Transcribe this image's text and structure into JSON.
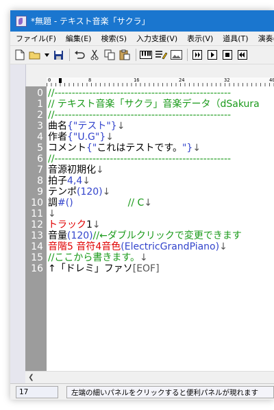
{
  "window": {
    "title": "*無題 - テキスト音楽「サクラ」"
  },
  "menu": {
    "items": [
      "ファイル(F)",
      "編集(E)",
      "検索(S)",
      "入力支援(V)",
      "表示(V)",
      "道具(T)",
      "演奏("
    ]
  },
  "toolbar": {
    "buttons": [
      "new-file-icon",
      "open-folder-icon",
      "dropdown-arrow-icon",
      "save-icon",
      "undo-icon",
      "cut-icon",
      "copy-icon",
      "paste-icon",
      "piano-icon",
      "edit-list-icon",
      "image-icon",
      "play-icon",
      "play-selection-icon",
      "stop-icon",
      "rewind-icon"
    ]
  },
  "ruler": {
    "labels": [
      "0",
      "8",
      "16",
      "24",
      "32",
      "40"
    ]
  },
  "editor": {
    "line_numbers": [
      "0",
      "1",
      "2",
      "3",
      "4",
      "5",
      "6",
      "7",
      "8",
      "9",
      "10",
      "11",
      "12",
      "13",
      "14",
      "15",
      "16"
    ],
    "lines": {
      "l0": "//---------------------------------------------------",
      "l1": "// テキスト音楽「サクラ」音楽データ（dSakura",
      "l2": "//---------------------------------------------------",
      "l3a": "曲名",
      "l3b": "{\"テスト\"}",
      "l3c": "↓",
      "l4a": "作者",
      "l4b": "{\"U.G\"}",
      "l4c": "↓",
      "l5a": "コメント",
      "l5b": "{\"",
      "l5c": "これはテストです。",
      "l5d": "\"}",
      "l5e": "↓",
      "l6": "//---------------------------------------------------",
      "l7a": "音源初期化",
      "l7b": "↓",
      "l8a": "拍子",
      "l8b": "4,4",
      "l8c": "↓",
      "l9a": "テンポ",
      "l9b": "(120)",
      "l9c": "↓",
      "l10a": "調",
      "l10b": "#()",
      "l10c": "// C",
      "l10d": "↓",
      "l11": "↓",
      "l12a": "トラック",
      "l12b": "1",
      "l12c": "↓",
      "l13a": "音量",
      "l13b": "(120)",
      "l13c": "//←ダブルクリックで変更できます",
      "l14a": "音階5 ",
      "l14b": "音符4",
      "l14c": "音色",
      "l14d": "(ElectricGrandPiano)",
      "l14e": "↓",
      "l15a": "//ここから書きます。",
      "l15b": "↓",
      "l16a": "↑「ドレミ」ファソ",
      "l16b": "[EOF]"
    }
  },
  "status": {
    "line": "17",
    "message": "左端の細いパネルをクリックすると便利パネルが現れます"
  },
  "colors": {
    "titlebar": "#1a76cf",
    "comment": "#1a9a1a",
    "number": "#3344cc",
    "track": "#e00000",
    "gutter": "#9c9c9c"
  }
}
